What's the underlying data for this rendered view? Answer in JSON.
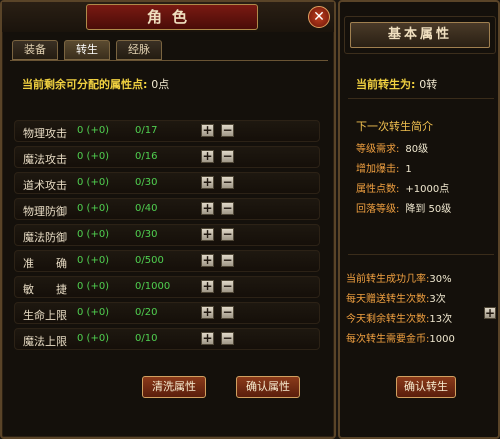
{
  "left": {
    "title": "角色",
    "close_glyph": "✕",
    "tabs": [
      {
        "label": "装备",
        "active": false
      },
      {
        "label": "转生",
        "active": true
      },
      {
        "label": "经脉",
        "active": false
      }
    ],
    "points_label": "当前剩余可分配的属性点:",
    "points_value": "0点",
    "stats": [
      {
        "name": "物理攻击",
        "current": "0 (+0)",
        "max": "0/17"
      },
      {
        "name": "魔法攻击",
        "current": "0 (+0)",
        "max": "0/16"
      },
      {
        "name": "道术攻击",
        "current": "0 (+0)",
        "max": "0/30"
      },
      {
        "name": "物理防御",
        "current": "0 (+0)",
        "max": "0/40"
      },
      {
        "name": "魔法防御",
        "current": "0 (+0)",
        "max": "0/30"
      },
      {
        "name": "准　　确",
        "current": "0 (+0)",
        "max": "0/500"
      },
      {
        "name": "敏　　捷",
        "current": "0 (+0)",
        "max": "0/1000"
      },
      {
        "name": "生命上限",
        "current": "0 (+0)",
        "max": "0/20"
      },
      {
        "name": "魔法上限",
        "current": "0 (+0)",
        "max": "0/10"
      }
    ],
    "plus_glyph": "+",
    "minus_glyph": "−",
    "wash_button": "清洗属性",
    "confirm_button": "确认属性"
  },
  "right": {
    "title": "基本属性",
    "rebirth_label": "当前转生为:",
    "rebirth_value": "0转",
    "next_title": "下一次转生简介",
    "next_info": [
      {
        "k": "等级需求:",
        "v": "80级"
      },
      {
        "k": "增加爆击:",
        "v": "1"
      },
      {
        "k": "属性点数:",
        "v": "+1000点"
      },
      {
        "k": "回落等级:",
        "v": "降到 50级"
      }
    ],
    "stats_lines": [
      {
        "k": "当前转生成功几率:",
        "v": "30%"
      },
      {
        "k": "每天赠送转生次数:",
        "v": "3次"
      },
      {
        "k": "今天剩余转生次数:",
        "v": "13次"
      },
      {
        "k": "每次转生需要金币:",
        "v": "1000"
      }
    ],
    "plus_glyph": "+",
    "rebirth_button": "确认转生"
  }
}
